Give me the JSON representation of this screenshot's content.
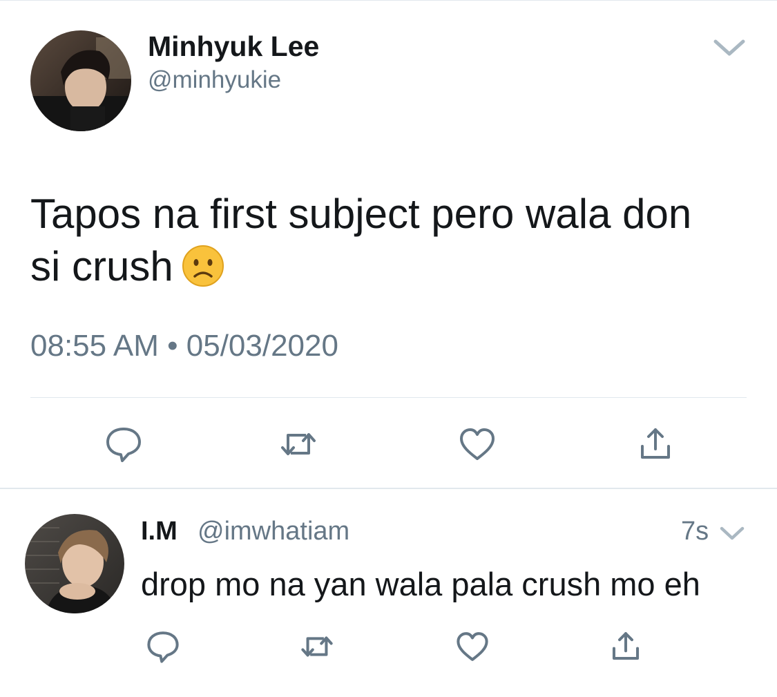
{
  "tweet": {
    "author_name": "Minhyuk Lee",
    "author_handle": "@minhyukie",
    "text_line1": "Tapos na first subject pero wala don",
    "text_line2": "si crush",
    "emoji": "frowning-face",
    "timestamp": "08:55 AM • 05/03/2020"
  },
  "reply": {
    "author_name": "I.M",
    "author_handle": "@imwhatiam",
    "age": "7s",
    "text": "drop mo na yan wala pala crush mo eh"
  },
  "actions": [
    "reply-icon",
    "retweet-icon",
    "like-icon",
    "share-icon"
  ],
  "colors": {
    "text": "#14171a",
    "secondary": "#657786",
    "icon": "#657786",
    "divider": "#e1e8ed",
    "emoji_face": "#f9c23c"
  }
}
